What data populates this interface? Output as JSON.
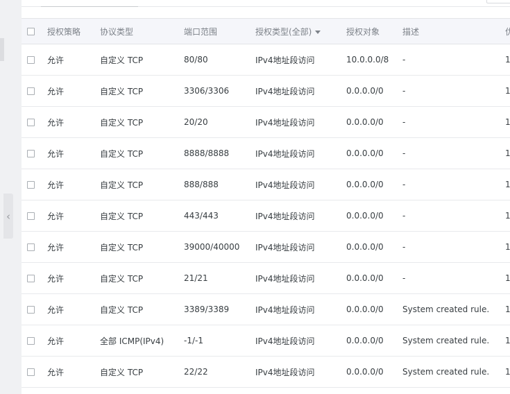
{
  "table": {
    "headers": {
      "policy": "授权策略",
      "protocol": "协议类型",
      "port_range": "端口范围",
      "auth_type": "授权类型(全部)",
      "auth_object": "授权对象",
      "description": "描述",
      "priority": "优"
    },
    "rows": [
      {
        "policy": "允许",
        "protocol": "自定义 TCP",
        "port_range": "80/80",
        "auth_type": "IPv4地址段访问",
        "auth_object": "10.0.0.0/8",
        "description": "-",
        "priority": "1"
      },
      {
        "policy": "允许",
        "protocol": "自定义 TCP",
        "port_range": "3306/3306",
        "auth_type": "IPv4地址段访问",
        "auth_object": "0.0.0.0/0",
        "description": "-",
        "priority": "1"
      },
      {
        "policy": "允许",
        "protocol": "自定义 TCP",
        "port_range": "20/20",
        "auth_type": "IPv4地址段访问",
        "auth_object": "0.0.0.0/0",
        "description": "-",
        "priority": "1"
      },
      {
        "policy": "允许",
        "protocol": "自定义 TCP",
        "port_range": "8888/8888",
        "auth_type": "IPv4地址段访问",
        "auth_object": "0.0.0.0/0",
        "description": "-",
        "priority": "1"
      },
      {
        "policy": "允许",
        "protocol": "自定义 TCP",
        "port_range": "888/888",
        "auth_type": "IPv4地址段访问",
        "auth_object": "0.0.0.0/0",
        "description": "-",
        "priority": "1"
      },
      {
        "policy": "允许",
        "protocol": "自定义 TCP",
        "port_range": "443/443",
        "auth_type": "IPv4地址段访问",
        "auth_object": "0.0.0.0/0",
        "description": "-",
        "priority": "1"
      },
      {
        "policy": "允许",
        "protocol": "自定义 TCP",
        "port_range": "39000/40000",
        "auth_type": "IPv4地址段访问",
        "auth_object": "0.0.0.0/0",
        "description": "-",
        "priority": "1"
      },
      {
        "policy": "允许",
        "protocol": "自定义 TCP",
        "port_range": "21/21",
        "auth_type": "IPv4地址段访问",
        "auth_object": "0.0.0.0/0",
        "description": "-",
        "priority": "1"
      },
      {
        "policy": "允许",
        "protocol": "自定义 TCP",
        "port_range": "3389/3389",
        "auth_type": "IPv4地址段访问",
        "auth_object": "0.0.0.0/0",
        "description": "System created rule.",
        "priority": "1"
      },
      {
        "policy": "允许",
        "protocol": "全部 ICMP(IPv4)",
        "port_range": "-1/-1",
        "auth_type": "IPv4地址段访问",
        "auth_object": "0.0.0.0/0",
        "description": "System created rule.",
        "priority": "1"
      },
      {
        "policy": "允许",
        "protocol": "自定义 TCP",
        "port_range": "22/22",
        "auth_type": "IPv4地址段访问",
        "auth_object": "0.0.0.0/0",
        "description": "System created rule.",
        "priority": "1"
      }
    ]
  },
  "icons": {
    "collapse_handle": "chevron-left-icon",
    "auth_type_filter": "caret-down-icon",
    "checkbox": "checkbox-unchecked-icon"
  },
  "colors": {
    "header_bg": "#f5f6fa",
    "header_text": "#7d8289",
    "row_border": "#e8e9ec",
    "sidebar_bg": "#f0f1f3"
  }
}
